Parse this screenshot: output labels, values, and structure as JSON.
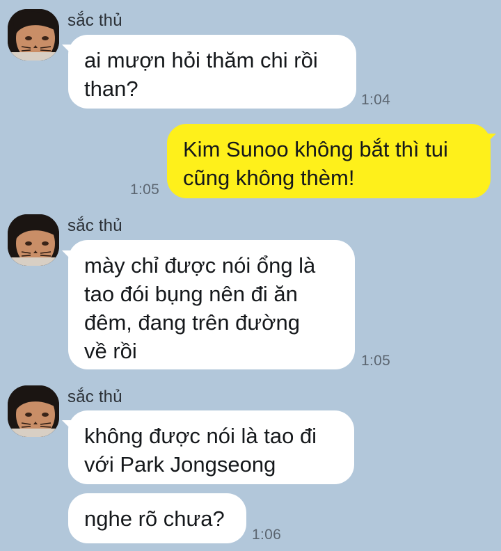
{
  "colors": {
    "background": "#b2c7da",
    "incoming_bubble": "#ffffff",
    "outgoing_bubble": "#fef01b",
    "timestamp": "#5b6570"
  },
  "groups": [
    {
      "sender": "sắc thủ",
      "avatar_icon": "profile-photo-cat-face",
      "messages": [
        {
          "text": "ai mượn hỏi thăm chi rồi\nthan?",
          "time": "1:04"
        }
      ]
    },
    {
      "outgoing": true,
      "messages": [
        {
          "text": "Kim Sunoo không bắt thì tui\ncũng không thèm!",
          "time": "1:05"
        }
      ]
    },
    {
      "sender": "sắc thủ",
      "avatar_icon": "profile-photo-cat-face",
      "messages": [
        {
          "text": "mày chỉ được nói ổng là\ntao đói bụng nên đi ăn\nđêm, đang trên đường\nvề rồi",
          "time": "1:05"
        }
      ]
    },
    {
      "sender": "sắc thủ",
      "avatar_icon": "profile-photo-cat-face",
      "messages": [
        {
          "text": "không được nói là tao đi\nvới Park Jongseong"
        },
        {
          "text": "nghe rõ chưa?",
          "time": "1:06"
        }
      ]
    }
  ]
}
